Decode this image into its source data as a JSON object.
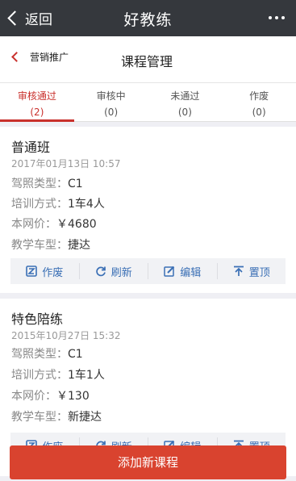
{
  "topbar": {
    "back_label": "返回",
    "title": "好教练"
  },
  "navbar": {
    "back_label": "营销推广",
    "title": "课程管理"
  },
  "tabs": [
    {
      "label": "审核通过",
      "count": "(2)"
    },
    {
      "label": "审核中",
      "count": "(0)"
    },
    {
      "label": "未通过",
      "count": "(0)"
    },
    {
      "label": "作废",
      "count": "(0)"
    }
  ],
  "courses": [
    {
      "name": "普通班",
      "time": "2017年01月13日 10:57",
      "license_label": "驾照类型：",
      "license": "C1",
      "mode_label": "培训方式：",
      "mode": "1车4人",
      "price_label": "本网价：",
      "price": "￥4680",
      "car_label": "教学车型：",
      "car": "捷达"
    },
    {
      "name": "特色陪练",
      "time": "2015年10月27日 15:32",
      "license_label": "驾照类型：",
      "license": "C1",
      "mode_label": "培训方式：",
      "mode": "1车1人",
      "price_label": "本网价：",
      "price": "￥130",
      "car_label": "教学车型：",
      "car": "新捷达"
    }
  ],
  "actions": {
    "void": "作废",
    "refresh": "刷新",
    "edit": "编辑",
    "top": "置顶"
  },
  "bottom_button": "添加新课程",
  "colors": {
    "accent": "#c9302c",
    "action_blue": "#3a6fb5",
    "topbar": "#35383d"
  }
}
